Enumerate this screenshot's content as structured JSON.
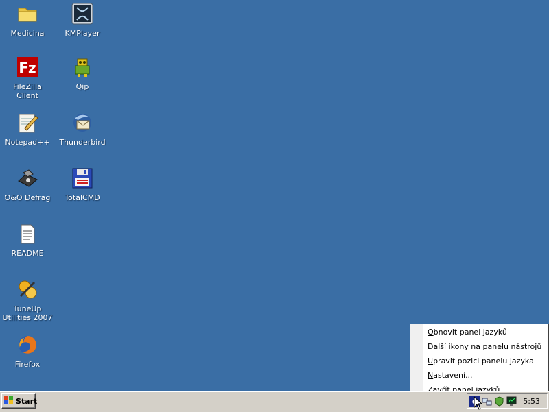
{
  "desktop": {
    "icons": [
      {
        "label": "Medicina",
        "icon": "folder-icon"
      },
      {
        "label": "KMPlayer",
        "icon": "kmplayer-icon"
      },
      {
        "label": "FileZilla Client",
        "icon": "filezilla-icon"
      },
      {
        "label": "Qip",
        "icon": "qip-icon"
      },
      {
        "label": "Notepad++",
        "icon": "notepadpp-icon"
      },
      {
        "label": "Thunderbird",
        "icon": "thunderbird-icon"
      },
      {
        "label": "O&O Defrag",
        "icon": "defrag-icon"
      },
      {
        "label": "TotalCMD",
        "icon": "totalcmd-icon"
      },
      {
        "label": "README",
        "icon": "text-file-icon"
      },
      {
        "label": "TuneUp Utilities 2007",
        "icon": "tuneup-icon"
      },
      {
        "label": "Firefox",
        "icon": "firefox-icon"
      }
    ]
  },
  "taskbar": {
    "start_label": "Start",
    "clock": "5:53",
    "tray_icons": [
      "language-bar-icon",
      "network-icon",
      "security-icon",
      "monitor-icon"
    ]
  },
  "context_menu": {
    "items": [
      {
        "accel": "O",
        "rest": "bnovit panel jazyků"
      },
      {
        "accel": "D",
        "rest": "alší ikony na panelu nástrojů"
      },
      {
        "accel": "U",
        "rest": "pravit pozici panelu jazyka"
      },
      {
        "accel": "N",
        "rest": "astavení..."
      },
      {
        "accel": "Z",
        "rest": "avřít panel jazyků"
      }
    ]
  },
  "colors": {
    "desktop_bg": "#3a6ea5",
    "taskbar_bg": "#d4d0c8"
  }
}
